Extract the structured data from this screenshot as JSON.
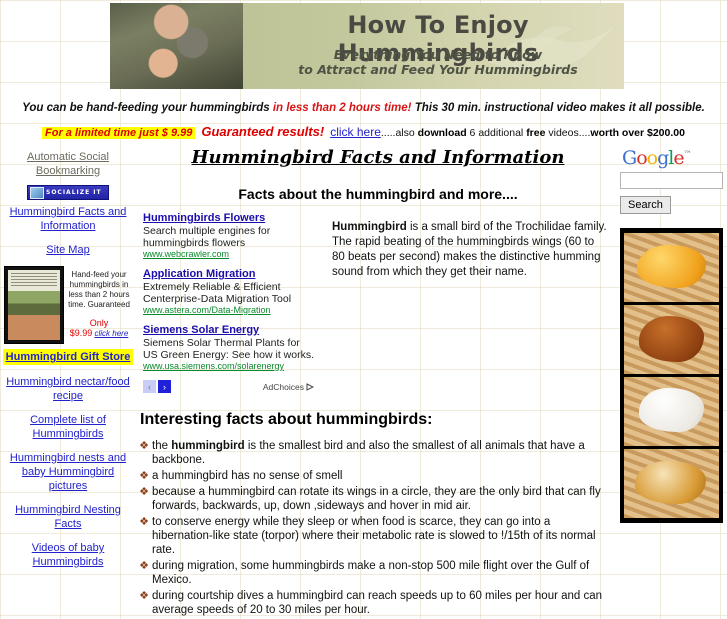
{
  "banner": {
    "title": "How To Enjoy Hummingbirds",
    "subtitle_line1": "Everything You Need to Know",
    "subtitle_line2": "to Attract and Feed Your Hummingbirds"
  },
  "promo": {
    "line1_part1": "You can be hand-feeding your hummingbirds ",
    "line1_highlight": "in less than 2 hours time!",
    "line1_part2": "  This 30 min. instructional video makes it all possible.",
    "limited_offer": "For a limited time  just  $ 9.99",
    "guaranteed": "Guaranteed results!",
    "click_here": "click here",
    "after1": ".....also ",
    "download": "download",
    "after2": " 6 additional ",
    "free": "free",
    "after3": " videos....",
    "worth": "worth over $200.00"
  },
  "sidebar": {
    "items": [
      {
        "label": "Automatic Social Bookmarking",
        "style": "gray"
      },
      {
        "label": "Hummingbird  Facts and Information",
        "style": "link"
      },
      {
        "label": "Site Map",
        "style": "link"
      },
      {
        "label": "Hummingbird Gift Store",
        "style": "highlight"
      },
      {
        "label": "Hummingbird nectar/food recipe",
        "style": "link"
      },
      {
        "label": "Complete list of Hummingbirds",
        "style": "link"
      },
      {
        "label": "Hummingbird nests and baby Hummingbird pictures",
        "style": "link"
      },
      {
        "label": "Hummingbird Nesting Facts",
        "style": "link"
      },
      {
        "label": "Videos of baby Hummingbirds ",
        "style": "link"
      }
    ],
    "socialize_badge": "SOCIALIZE IT",
    "dvd": {
      "pitch": "Hand-feed your hummingbirds in less than 2 hours time. Guaranteed",
      "only": "Only",
      "price": "$9.99",
      "click": "click here"
    }
  },
  "main": {
    "title": "Hummingbird Facts and Information",
    "subtitle": "Facts about the hummingbird and more....",
    "intro_bold": "Hummingbird",
    "intro_rest": " is a small bird of the Trochilidae family. The rapid beating of the hummingbirds wings (60 to 80 beats per second) makes the distinctive humming sound from which they get their name.",
    "facts_heading": "Interesting facts about hummingbirds:",
    "facts": [
      {
        "pre": "the ",
        "bold": "hummingbird",
        "post": " is the smallest bird and also the smallest of all animals that have a backbone."
      },
      {
        "pre": "a hummingbird has no sense of smell",
        "bold": "",
        "post": ""
      },
      {
        "pre": "because a hummingbird can rotate its wings in a circle, they are the only bird that can fly forwards, backwards, up, down ,sideways and  hover in mid air.",
        "bold": "",
        "post": ""
      },
      {
        "pre": "to conserve energy while they sleep or when food is scarce, they can go into a hibernation-like state (torpor) where their metabolic rate is slowed to !/15th of its normal rate.",
        "bold": "",
        "post": ""
      },
      {
        "pre": "during migration, some hummingbirds make a non-stop 500 mile flight over the Gulf of Mexico.",
        "bold": "",
        "post": ""
      },
      {
        "pre": "during courtship dives a hummingbird can reach speeds up to 60 miles per hour and can average speeds of 20 to 30 miles per hour.",
        "bold": "",
        "post": ""
      }
    ]
  },
  "ads": {
    "items": [
      {
        "title": "Hummingbirds Flowers",
        "desc": "Search multiple engines for hummingbirds flowers",
        "url": "www.webcrawler.com"
      },
      {
        "title": "Application Migration",
        "desc": "Extremely Reliable & Efficient Centerprise-Data Migration Tool",
        "url": "www.astera.com/Data-Migration"
      },
      {
        "title": "Siemens Solar Energy",
        "desc": "Siemens Solar Thermal Plants for US Green Energy: See how it works.",
        "url": "www.usa.siemens.com/solarenergy"
      }
    ],
    "prev": "‹",
    "next": "›",
    "adchoices": "AdChoices"
  },
  "search": {
    "brand": "Google",
    "value": "",
    "placeholder": "",
    "button": "Search"
  },
  "colors": {
    "link": "#2222cc",
    "ad_link": "#1a0dab",
    "ad_url": "#0a8a2e",
    "red": "#e00000",
    "highlight": "#ffff00",
    "banner_bg": "#c2c79c"
  }
}
